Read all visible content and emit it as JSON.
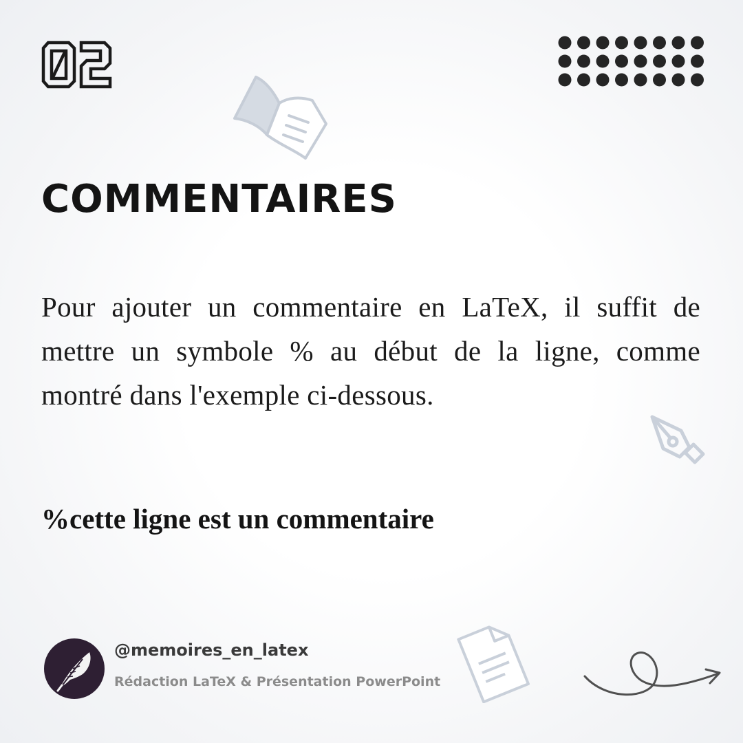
{
  "slide": {
    "number": "02"
  },
  "title": "COMMENTAIRES",
  "body": "Pour ajouter un commentaire en LaTeX, il suffit de mettre un symbole % au début de la ligne, comme montré dans l'exemple ci-dessous.",
  "example": "%cette ligne est un commentaire",
  "footer": {
    "handle": "@memoires_en_latex",
    "tagline": "Rédaction LaTeX & Présentation PowerPoint"
  },
  "colors": {
    "text": "#141414",
    "avatar_bg": "#2e1f33",
    "decor_icons": "#d5dbe3",
    "dots": "#252525"
  },
  "icons": [
    "open-book-icon",
    "fountain-pen-icon",
    "document-icon",
    "feather-icon",
    "curly-arrow-icon"
  ]
}
